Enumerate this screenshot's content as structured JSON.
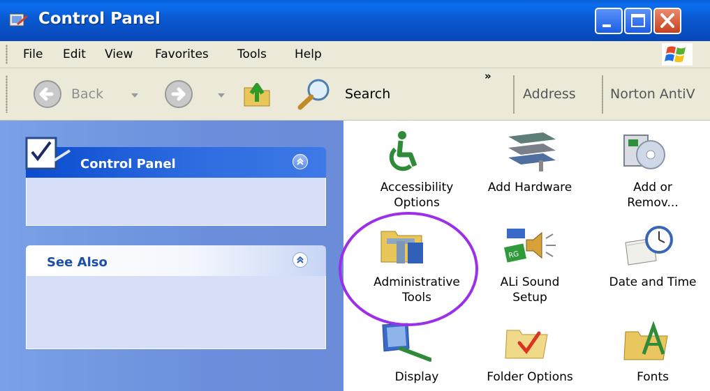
{
  "window": {
    "title": "Control Panel"
  },
  "menu": {
    "items": [
      "File",
      "Edit",
      "View",
      "Favorites",
      "Tools",
      "Help"
    ]
  },
  "toolbar": {
    "back_label": "Back",
    "search_label": "Search",
    "chevron": "»",
    "address_label": "Address",
    "norton_label": "Norton AntiV"
  },
  "sidebar": {
    "control_panel_title": "Control Panel",
    "see_also_title": "See Also"
  },
  "items": [
    {
      "line1": "Accessibility",
      "line2": "Options",
      "icon": "accessibility-icon"
    },
    {
      "line1": "Add Hardware",
      "line2": "",
      "icon": "add-hardware-icon"
    },
    {
      "line1": "Add or",
      "line2": "Remov...",
      "icon": "add-remove-programs-icon"
    },
    {
      "line1": "Administrative",
      "line2": "Tools",
      "icon": "administrative-tools-icon"
    },
    {
      "line1": "ALi Sound",
      "line2": "Setup",
      "icon": "ali-sound-icon"
    },
    {
      "line1": "Date and Time",
      "line2": "",
      "icon": "date-time-icon"
    },
    {
      "line1": "Display",
      "line2": "",
      "icon": "display-icon"
    },
    {
      "line1": "Folder Options",
      "line2": "",
      "icon": "folder-options-icon"
    },
    {
      "line1": "Fonts",
      "line2": "",
      "icon": "fonts-icon"
    }
  ],
  "colors": {
    "titlebar": "#0a59d0",
    "sidebar": "#6b8fdc",
    "highlight_circle": "#9b30e8"
  }
}
